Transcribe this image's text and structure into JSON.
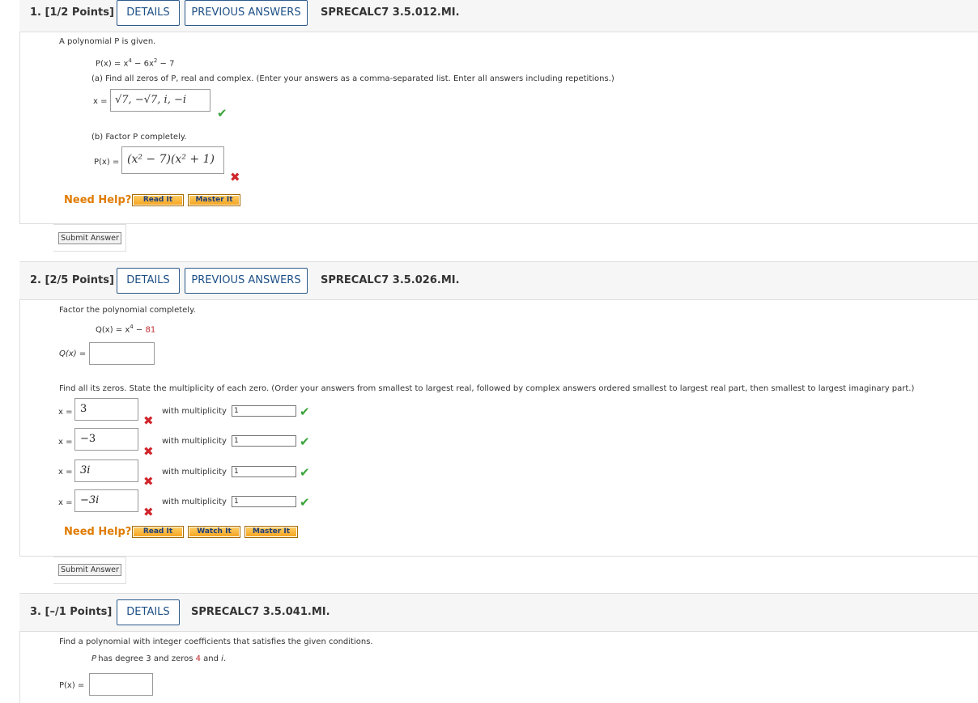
{
  "q1": {
    "number": "1. [1/2 Points]",
    "details_label": "DETAILS",
    "prev_label": "PREVIOUS ANSWERS",
    "code": "SPRECALC7 3.5.012.MI.",
    "intro": "A polynomial P is given.",
    "eq_left": "P(x) = x",
    "eq_exp1": "4",
    "eq_mid": " − 6x",
    "eq_exp2": "2",
    "eq_end": " − 7",
    "part_a": "(a) Find all zeros of P, real and complex. (Enter your answers as a comma-separated list. Enter all answers including repetitions.)",
    "x_label": "x =",
    "answer_a": "√7, −√7, i, −i",
    "part_b": "(b) Factor P completely.",
    "px_label": "P(x) =",
    "answer_b": "(x² − 7)(x² + 1)",
    "need_help": "Need Help?",
    "read_it": "Read It",
    "master_it": "Master It",
    "submit": "Submit Answer"
  },
  "q2": {
    "number": "2. [2/5 Points]",
    "details_label": "DETAILS",
    "prev_label": "PREVIOUS ANSWERS",
    "code": "SPRECALC7 3.5.026.MI.",
    "intro": "Factor the polynomial completely.",
    "eq_left": "Q(x) = x",
    "eq_exp": "4",
    "eq_mid": " − ",
    "eq_const": "81",
    "qx_label": "Q(x) =",
    "zeros_prompt": "Find all its zeros. State the multiplicity of each zero. (Order your answers from smallest to largest real, followed by complex answers ordered smallest to largest real part, then smallest to largest imaginary part.)",
    "x_label": "x =",
    "with_multiplicity": "with multiplicity",
    "zeros": [
      {
        "value": "3",
        "multiplicity": "1"
      },
      {
        "value": "−3",
        "multiplicity": "1"
      },
      {
        "value": "3i",
        "multiplicity": "1"
      },
      {
        "value": "−3i",
        "multiplicity": "1"
      }
    ],
    "need_help": "Need Help?",
    "read_it": "Read It",
    "watch_it": "Watch It",
    "master_it": "Master It",
    "submit": "Submit Answer"
  },
  "q3": {
    "number": "3. [–/1 Points]",
    "details_label": "DETAILS",
    "code": "SPRECALC7 3.5.041.MI.",
    "intro": "Find a polynomial with integer coefficients that satisfies the given conditions.",
    "cond_pre": "P has degree 3 and zeros ",
    "cond_z1": "4",
    "cond_and": " and ",
    "cond_z2": "i",
    "cond_end": ".",
    "px_label": "P(x) ="
  },
  "icons": {
    "check": "check-icon",
    "cross": "cross-icon",
    "check_color": "#3aa33a",
    "cross_color": "#d0252b",
    "help_orange": "#e07b00"
  }
}
